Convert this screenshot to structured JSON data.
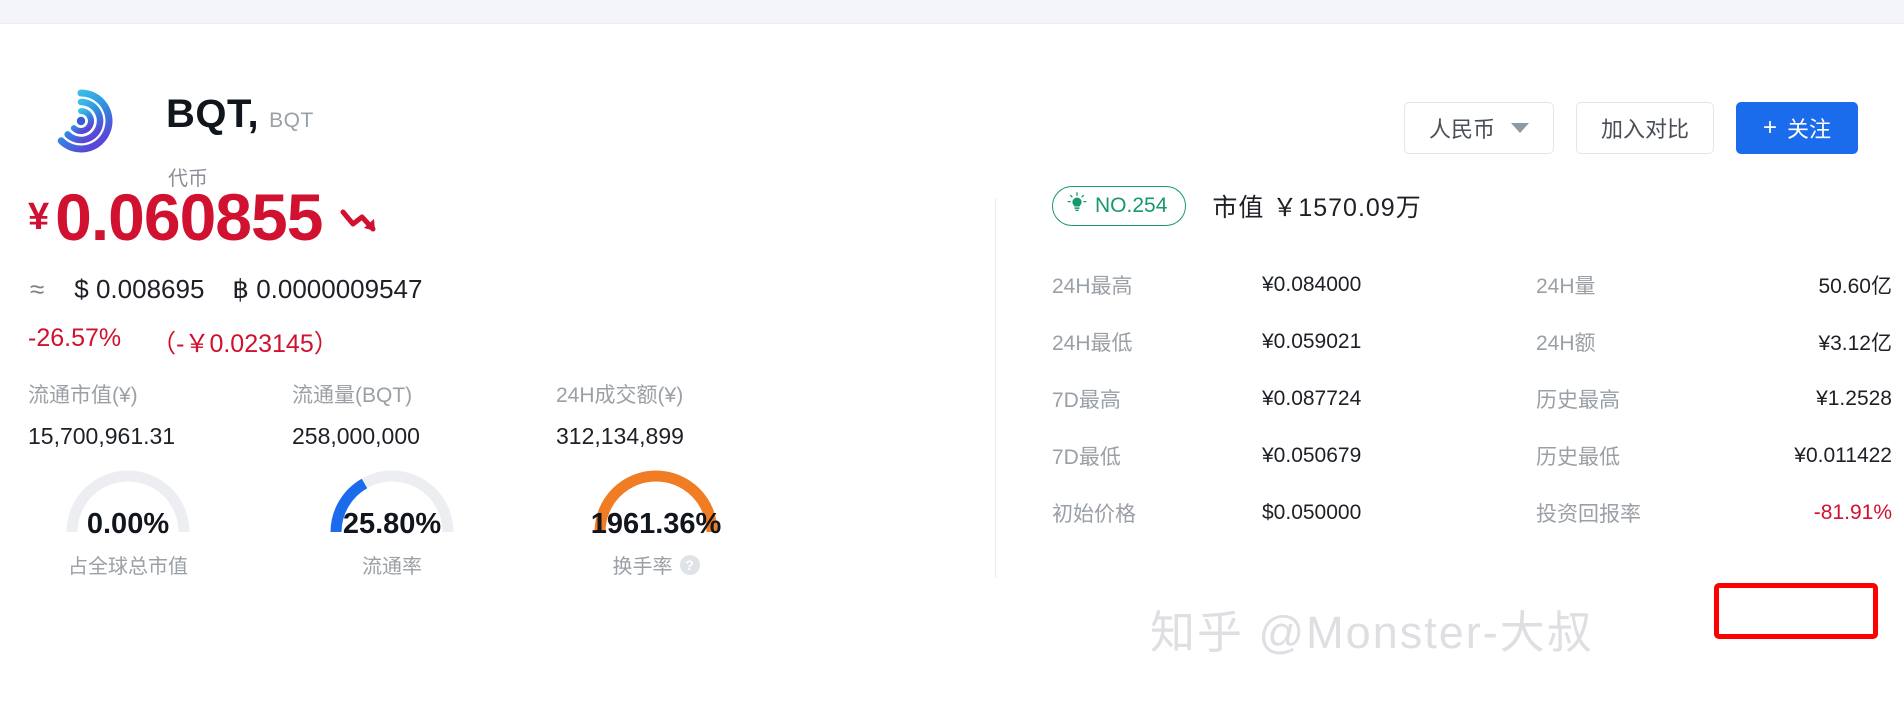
{
  "header": {
    "coin_symbol": "BQT,",
    "coin_ticker": "BQT",
    "coin_type": "代币",
    "currency_selector": "人民币",
    "compare_button": "加入对比",
    "follow_button": "关注",
    "follow_plus": "+"
  },
  "price": {
    "currency_mark": "¥",
    "value": "0.060855",
    "approx_mark": "≈",
    "usd": "$ 0.008695",
    "btc": "฿ 0.0000009547",
    "change_percent": "-26.57%",
    "change_absolute": "（-￥0.023145）",
    "trend": "down",
    "color": "#d0112f"
  },
  "left_stats": [
    {
      "label": "流通市值(¥)",
      "value": "15,700,961.31"
    },
    {
      "label": "流通量(BQT)",
      "value": "258,000,000"
    },
    {
      "label": "24H成交额(¥)",
      "value": "312,134,899"
    }
  ],
  "gauges": [
    {
      "percent_text": "0.00%",
      "percent": 0,
      "name": "占全球总市值",
      "color": "#eceef1",
      "has_help": false
    },
    {
      "percent_text": "25.80%",
      "percent": 25.8,
      "name": "流通率",
      "color": "#1b6cec",
      "has_help": false
    },
    {
      "percent_text": "1961.36%",
      "percent": 100,
      "name": "换手率",
      "color": "#f07c24",
      "has_help": true,
      "help_glyph": "?"
    }
  ],
  "right_panel": {
    "rank_badge": "NO.254",
    "rank_icon": "lightbulb-icon",
    "market_cap_label": "市值",
    "market_cap_value": "￥1570.09万",
    "rows": [
      {
        "label_a": "24H最高",
        "value_a": "¥0.084000",
        "label_b": "24H量",
        "value_b": "50.60亿"
      },
      {
        "label_a": "24H最低",
        "value_a": "¥0.059021",
        "label_b": "24H额",
        "value_b": "¥3.12亿"
      },
      {
        "label_a": "7D最高",
        "value_a": "¥0.087724",
        "label_b": "历史最高",
        "value_b": "¥1.2528"
      },
      {
        "label_a": "7D最低",
        "value_a": "¥0.050679",
        "label_b": "历史最低",
        "value_b": "¥0.011422"
      },
      {
        "label_a": "初始价格",
        "value_a": "$0.050000",
        "label_b": "投资回报率",
        "value_b": "-81.91%"
      }
    ]
  },
  "annotation": {
    "highlight_color": "#fe0000",
    "highlight_target": "投资回报率"
  },
  "watermark": {
    "text": "知乎 @Monster-大叔"
  }
}
